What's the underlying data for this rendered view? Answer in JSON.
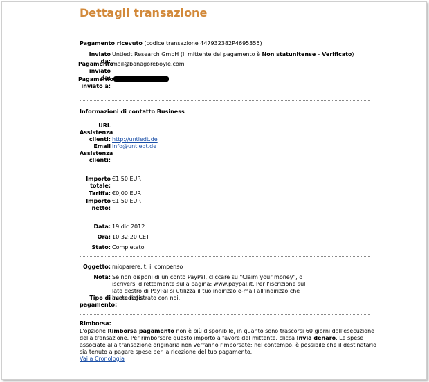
{
  "page": {
    "title": "Dettagli transazione"
  },
  "payment": {
    "heading": "Pagamento ricevuto",
    "transaction_code": "(codice transazione 447932382P4695355)",
    "sent_to_label": "Inviato da:",
    "sent_to_value": "Untiedt Research GmbH (Il mittente del pagamento è ",
    "sent_to_status": "Non statunitense - Verificato",
    "sent_to_close": ")",
    "sender_payment_label": "Pagamento inviato da:",
    "sender_payment_value": "mail@banagoreboyle.com",
    "recipient_payment_label": "Pagamento inviato a:"
  },
  "business": {
    "heading": "Informazioni di contatto Business",
    "url_label": "URL Assistenza clienti:",
    "url_value": "http://untiedt.de",
    "email_label": "Email Assistenza clienti:",
    "email_value": "info@untiedt.de"
  },
  "amounts": {
    "total_label": "Importo totale:",
    "total_value": "€1,50 EUR",
    "fee_label": "Tariffa:",
    "fee_value": "€0,00 EUR",
    "net_label": "Importo netto:",
    "net_value": "€1,50 EUR"
  },
  "details": {
    "date_label": "Data:",
    "date_value": "19 dic 2012",
    "time_label": "Ora:",
    "time_value": "10:32:20 CET",
    "status_label": "Stato:",
    "status_value": "Completato"
  },
  "message": {
    "subject_label": "Oggetto:",
    "subject_value": "mioparere.it: il compenso",
    "note_label": "Nota:",
    "note_value": "Se non disponi di un conto PayPal, cliccare su \"Claim your money\", o iscriversi direttamente sulla pagina: www.paypal.it. Per l'iscrizione sul lato destro di PayPal si utilizza il tuo indirizzo e-mail all'indirizzo che avete registrato con noi.",
    "payment_type_label": "Tipo di pagamento:",
    "payment_type_value": "Immediato"
  },
  "refund": {
    "heading": "Rimborsa:",
    "text_1": "L'opzione ",
    "text_bold_1": "Rimborsa pagamento",
    "text_2": " non è più disponibile, in quanto sono trascorsi 60 giorni dall'esecuzione della transazione. Per rimborsare questo importo a favore del mittente, clicca ",
    "text_bold_2": "Invia denaro",
    "text_3": ". Le spese associate alla transazione originaria non verranno rimborsate; nel contempo, è possibile che il destinatario sia tenuto a pagare spese per la ricezione del tuo pagamento.",
    "history_link": "Vai a Cronologia"
  }
}
